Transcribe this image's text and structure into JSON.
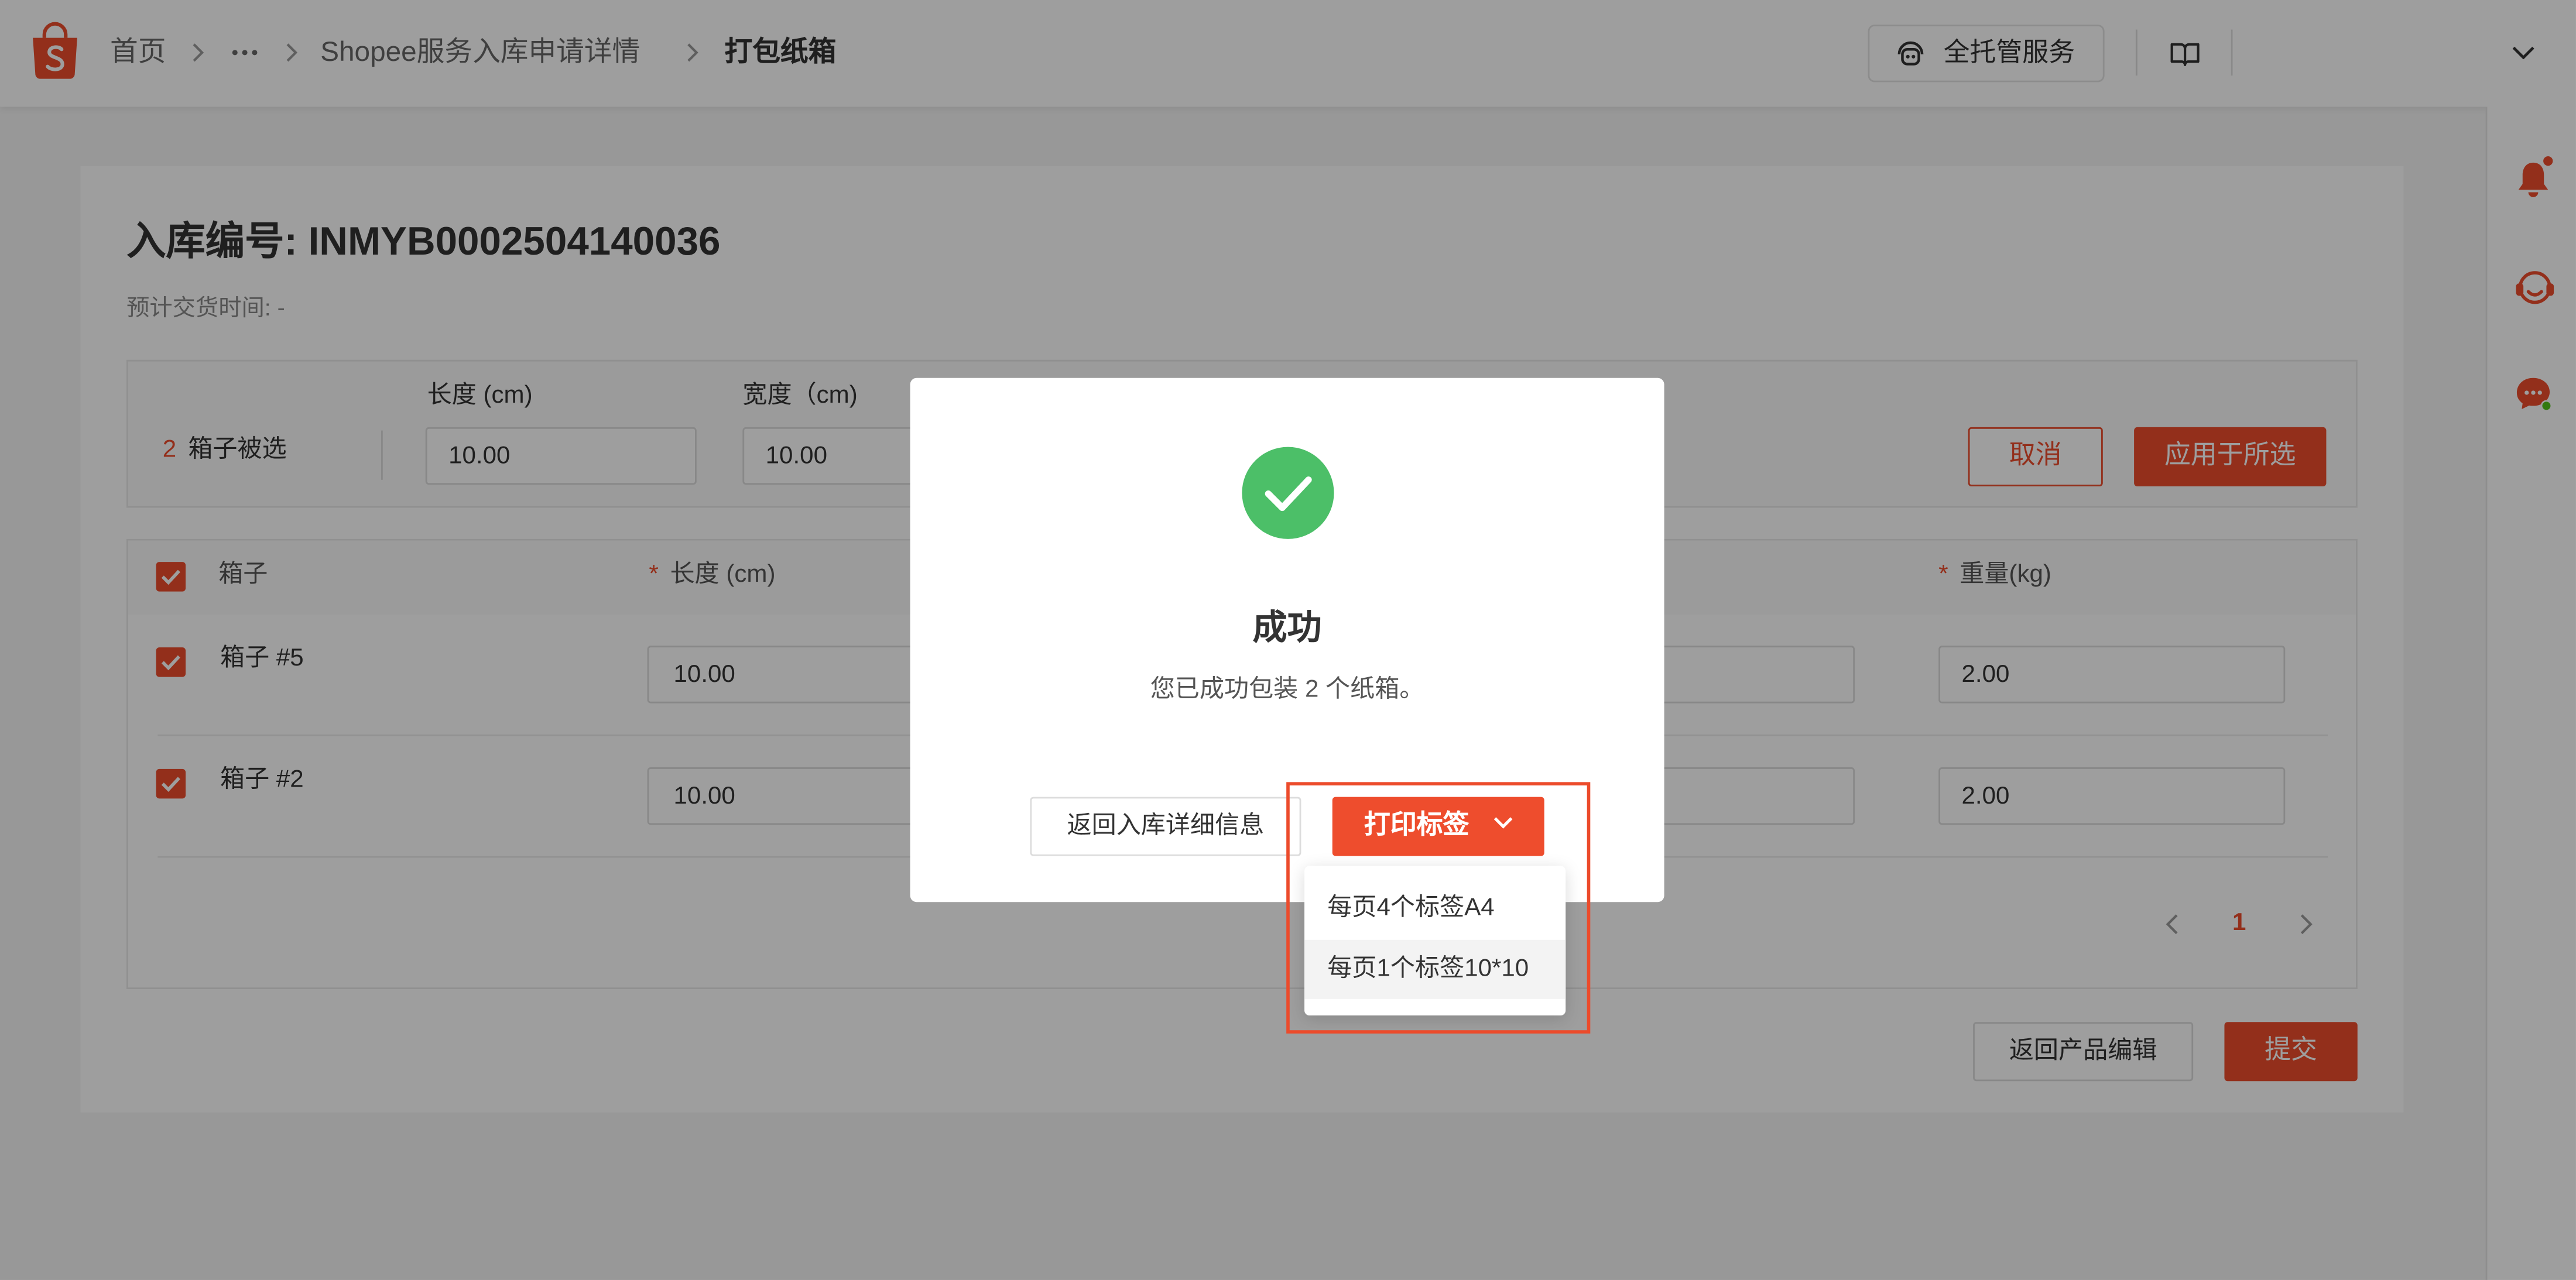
{
  "header": {
    "breadcrumb": {
      "home": "首页",
      "parent": "Shopee服务入库申请详情",
      "current": "打包纸箱"
    },
    "service_button_label": "全托管服务"
  },
  "page": {
    "title": "入库编号: INMYB0002504140036",
    "delivery_time": "预计交货时间: -"
  },
  "batch_edit": {
    "selected_count": "2",
    "selected_label": "箱子被选",
    "length_label": "长度 (cm)",
    "length_value": "10.00",
    "width_label": "宽度（cm)",
    "width_value": "10.00",
    "cancel_label": "取消",
    "apply_label": "应用于所选"
  },
  "table": {
    "required_mark": "*",
    "columns": {
      "box": "箱子",
      "length": "长度 (cm)",
      "weight": "重量(kg)"
    },
    "rows": [
      {
        "name": "箱子 #5",
        "length": "10.00",
        "weight": "2.00",
        "checked": true
      },
      {
        "name": "箱子 #2",
        "length": "10.00",
        "weight": "2.00",
        "checked": true
      }
    ]
  },
  "pagination": {
    "current": "1"
  },
  "footer": {
    "back_label": "返回产品编辑",
    "submit_label": "提交"
  },
  "modal": {
    "title": "成功",
    "message": "您已成功包装 2 个纸箱。",
    "back_label": "返回入库详细信息",
    "print_label": "打印标签",
    "print_options": [
      "每页4个标签A4",
      "每页1个标签10*10"
    ],
    "hovered_option_index": 1
  },
  "icons": [
    "shopee-logo-icon",
    "chevron-right-icon",
    "ellipsis-icon",
    "robot-service-icon",
    "book-icon",
    "chevron-down-icon",
    "bell-icon",
    "headset-icon",
    "chat-icon",
    "checkbox-checked-icon",
    "success-check-icon",
    "chevron-left-icon"
  ],
  "colors": {
    "accent": "#ee4d2d",
    "success": "#4cbf68",
    "highlight": "#ec4b2b"
  }
}
